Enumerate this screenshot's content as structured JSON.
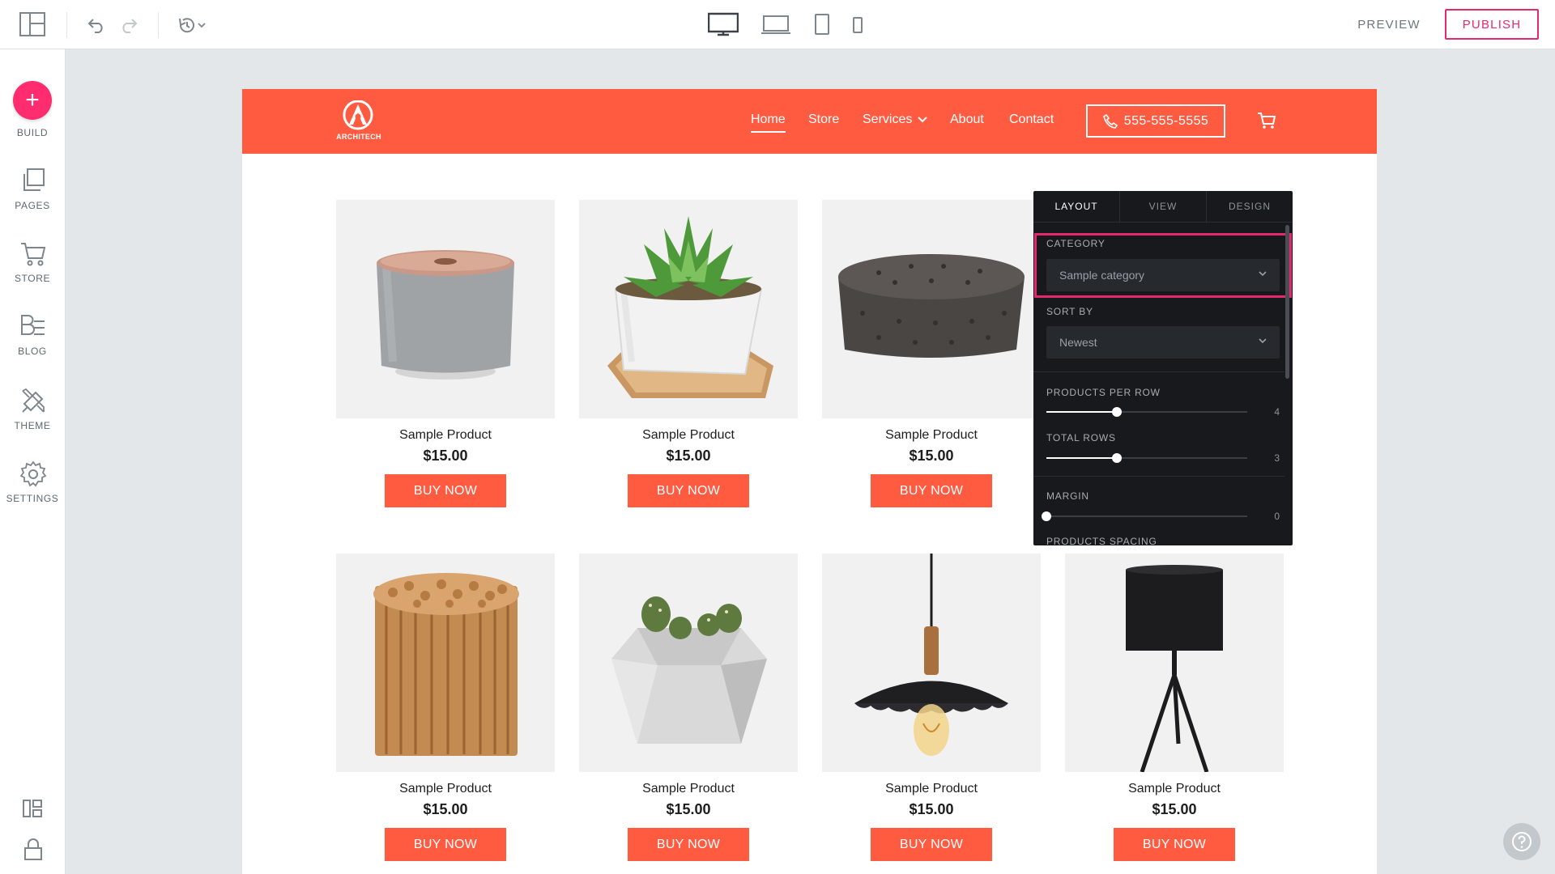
{
  "topbar": {
    "preview_label": "PREVIEW",
    "publish_label": "PUBLISH"
  },
  "leftrail": {
    "items": [
      {
        "label": "BUILD",
        "icon": "plus-icon"
      },
      {
        "label": "PAGES",
        "icon": "pages-icon"
      },
      {
        "label": "STORE",
        "icon": "cart-icon"
      },
      {
        "label": "BLOG",
        "icon": "blog-icon"
      },
      {
        "label": "THEME",
        "icon": "brush-icon"
      },
      {
        "label": "SETTINGS",
        "icon": "gear-icon"
      }
    ]
  },
  "site": {
    "brand_color": "#ff5b41",
    "logo_text": "ARCHITECH",
    "nav": [
      "Home",
      "Store",
      "Services",
      "About",
      "Contact"
    ],
    "phone": "555-555-5555"
  },
  "products": [
    {
      "name": "Sample Product",
      "price": "$15.00",
      "buy_label": "BUY NOW",
      "image": "concrete-candle"
    },
    {
      "name": "Sample Product",
      "price": "$15.00",
      "buy_label": "BUY NOW",
      "image": "succulent-pot"
    },
    {
      "name": "Sample Product",
      "price": "$15.00",
      "buy_label": "BUY NOW",
      "image": "tufted-ottoman"
    },
    {
      "name": "Sample Product",
      "price": "$15.00",
      "buy_label": "BUY NOW",
      "image": "wood-stool"
    },
    {
      "name": "Sample Product",
      "price": "$15.00",
      "buy_label": "BUY NOW",
      "image": "cactus-pot"
    },
    {
      "name": "Sample Product",
      "price": "$15.00",
      "buy_label": "BUY NOW",
      "image": "pendant-lamp"
    },
    {
      "name": "Sample Product",
      "price": "$15.00",
      "buy_label": "BUY NOW",
      "image": "tripod-lamp"
    }
  ],
  "panel": {
    "tabs": [
      "LAYOUT",
      "VIEW",
      "DESIGN"
    ],
    "active_tab": "LAYOUT",
    "category_label": "CATEGORY",
    "category_value": "Sample category",
    "sort_label": "SORT BY",
    "sort_value": "Newest",
    "per_row_label": "PRODUCTS PER ROW",
    "per_row_value": "4",
    "per_row_fraction": 0.35,
    "rows_label": "TOTAL ROWS",
    "rows_value": "3",
    "rows_fraction": 0.35,
    "margin_label": "MARGIN",
    "margin_value": "0",
    "margin_fraction": 0.0,
    "spacing_label": "PRODUCTS SPACING",
    "highlight_color": "#e6286e"
  }
}
